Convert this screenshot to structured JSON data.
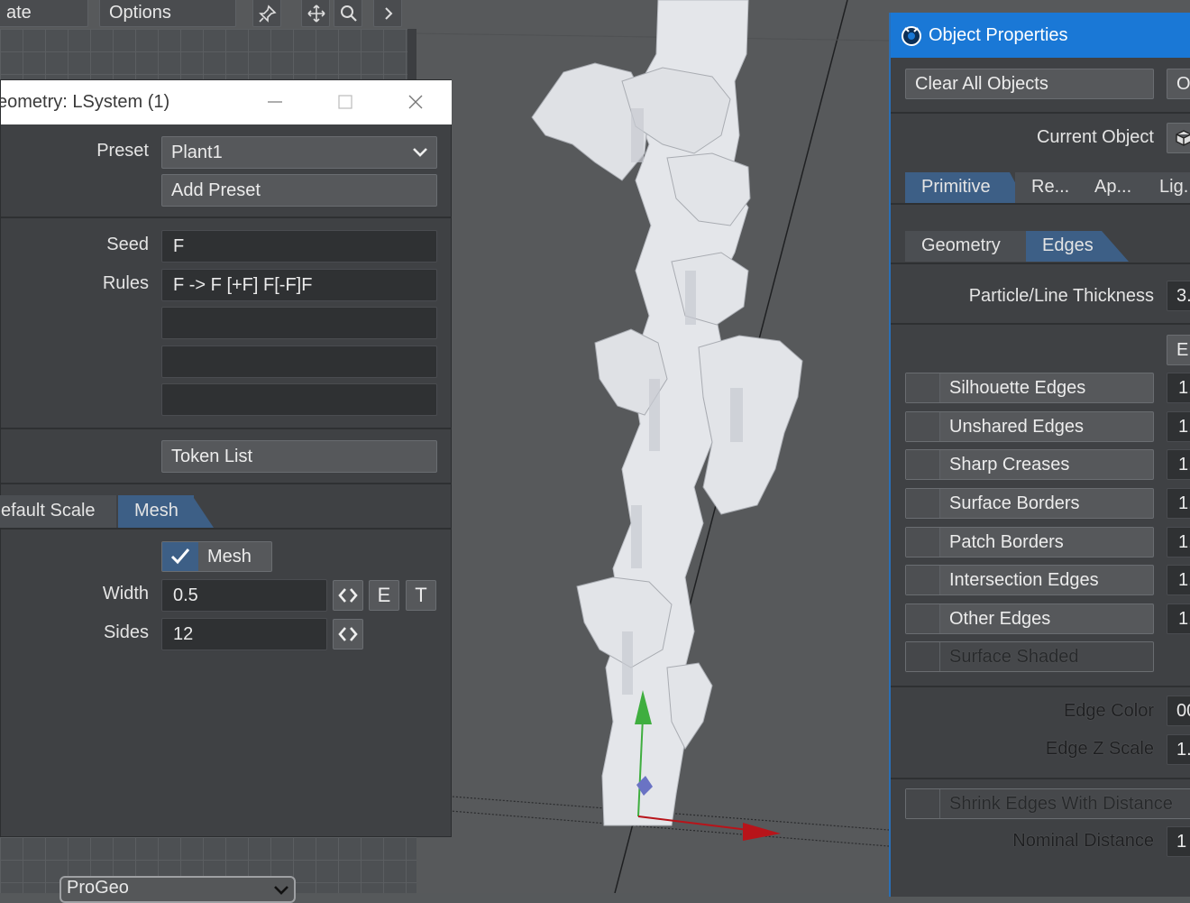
{
  "toolbar": {
    "left_partial_label": "ate",
    "options_label": "Options"
  },
  "lsystem": {
    "title": "eometry: LSystem (1)",
    "preset_label": "Preset",
    "preset_value": "Plant1",
    "add_preset_label": "Add Preset",
    "seed_label": "Seed",
    "seed_value": "F",
    "rules_label": "Rules",
    "rules": [
      "F -> F [+F] F[-F]F",
      "",
      "",
      ""
    ],
    "token_list_label": "Token List",
    "tabs": [
      "efault Scale",
      "Mesh"
    ],
    "mesh_checkbox_label": "Mesh",
    "mesh_checked": true,
    "width_label": "Width",
    "width_value": "0.5",
    "sides_label": "Sides",
    "sides_value": "12",
    "env_e": "E",
    "env_t": "T"
  },
  "progeo_label": "ProGeo",
  "object_properties": {
    "title": "Object Properties",
    "clear_all_label": "Clear All Objects",
    "partial_right_btn": "O",
    "current_object_label": "Current Object",
    "main_tabs": [
      "Primitive",
      "Re...",
      "Ap...",
      "Lig..."
    ],
    "sub_tabs": [
      "Geometry",
      "Edges"
    ],
    "thickness_label": "Particle/Line Thickness",
    "thickness_value": "3.",
    "edges_partial_btn": "E",
    "edge_items": [
      {
        "label": "Silhouette Edges",
        "value": "1.",
        "disabled": false
      },
      {
        "label": "Unshared Edges",
        "value": "1.",
        "disabled": false
      },
      {
        "label": "Sharp Creases",
        "value": "1.",
        "disabled": false
      },
      {
        "label": "Surface Borders",
        "value": "1.",
        "disabled": false
      },
      {
        "label": "Patch Borders",
        "value": "1.",
        "disabled": false
      },
      {
        "label": "Intersection Edges",
        "value": "1.",
        "disabled": false
      },
      {
        "label": "Other Edges",
        "value": "1.",
        "disabled": false
      },
      {
        "label": "Surface Shaded",
        "value": "",
        "disabled": true
      }
    ],
    "edge_color_label": "Edge Color",
    "edge_color_value": "00",
    "edge_z_scale_label": "Edge Z Scale",
    "edge_z_scale_value": "1.",
    "shrink_edges_label": "Shrink Edges With Distance",
    "nominal_distance_label": "Nominal Distance",
    "nominal_distance_value": "1"
  },
  "colors": {
    "accent_blue": "#3d5f86",
    "titlebar_blue": "#1a78d6",
    "axis_y": "#3fae3f",
    "axis_x": "#b8141a"
  }
}
